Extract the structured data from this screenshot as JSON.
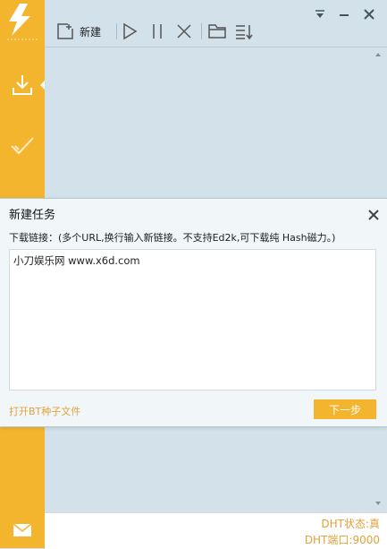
{
  "toolbar": {
    "new_label": "新建",
    "icons": [
      "new-task-icon",
      "start-icon",
      "pause-icon",
      "delete-icon",
      "folder-icon",
      "sort-icon"
    ]
  },
  "window_controls": [
    "dropdown-icon",
    "minimize-icon",
    "close-icon"
  ],
  "sidebar": {
    "items": [
      {
        "icon": "download-icon",
        "active": true
      },
      {
        "icon": "completed-check-icon",
        "active": false
      }
    ],
    "bottom_icon": "mail-icon"
  },
  "dialog": {
    "title": "新建任务",
    "prompt": "下载链接：(多个URL,换行输入新链接。不支持Ed2k,可下载纯 Hash磁力。)",
    "textarea_value": "小刀娱乐网 www.x6d.com",
    "open_bt_link": "打开BT种子文件",
    "next_button": "下一步"
  },
  "status": {
    "dht_state": "DHT状态:真",
    "dht_port": "DHT端口:9000"
  },
  "colors": {
    "accent": "#f4b52e",
    "background": "#d3e2ea",
    "status_text": "#e0a23a"
  }
}
